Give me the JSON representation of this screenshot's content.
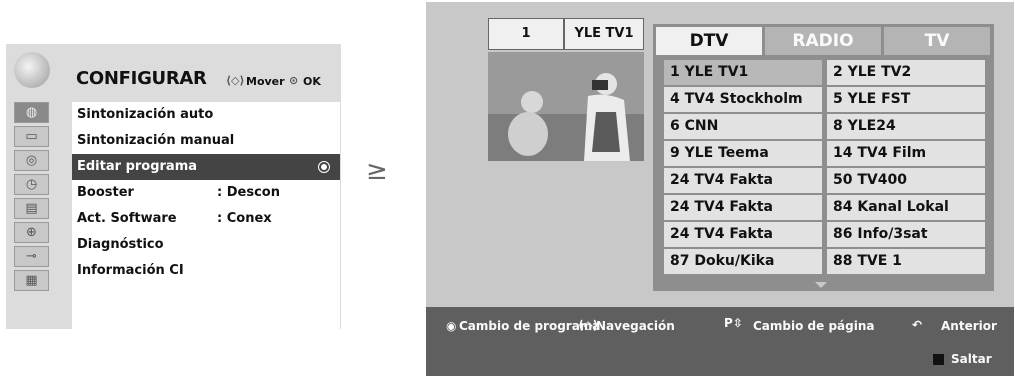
{
  "menu": {
    "title": "CONFIGURAR",
    "hint_move": "Mover",
    "hint_ok": "OK",
    "side_icons": [
      "globe-icon",
      "screen-icon",
      "speaker-icon",
      "clock-icon",
      "lock-icon",
      "padlock-icon",
      "plug-icon",
      "keyboard-icon"
    ],
    "items": [
      {
        "label": "Sintonización auto",
        "value": ""
      },
      {
        "label": "Sintonización manual",
        "value": ""
      },
      {
        "label": "Editar programa",
        "value": "",
        "selected": true
      },
      {
        "label": "Booster",
        "value": ": Descon"
      },
      {
        "label": "Act. Software",
        "value": ": Conex"
      },
      {
        "label": "Diagnóstico",
        "value": ""
      },
      {
        "label": "Información CI",
        "value": ""
      }
    ]
  },
  "arrow": "≥",
  "tv": {
    "current_number": "1",
    "current_name": "YLE TV1",
    "tabs": [
      "DTV",
      "RADIO",
      "TV"
    ],
    "channels": [
      [
        "1 YLE TV1",
        "2 YLE TV2"
      ],
      [
        "4 TV4 Stockholm",
        "5 YLE FST"
      ],
      [
        "6 CNN",
        "8 YLE24"
      ],
      [
        "9 YLE Teema",
        "14 TV4 Film"
      ],
      [
        "24 TV4 Fakta",
        "50 TV400"
      ],
      [
        "24 TV4 Fakta",
        "84 Kanal Lokal"
      ],
      [
        "24 TV4 Fakta",
        "86 Info/3sat"
      ],
      [
        "87 Doku/Kika",
        "88 TVE 1"
      ]
    ],
    "bottom": {
      "change_program": "Cambio de programa",
      "navigation": "Navegación",
      "page_change": "Cambio de página",
      "back": "Anterior",
      "skip": "Saltar"
    }
  }
}
